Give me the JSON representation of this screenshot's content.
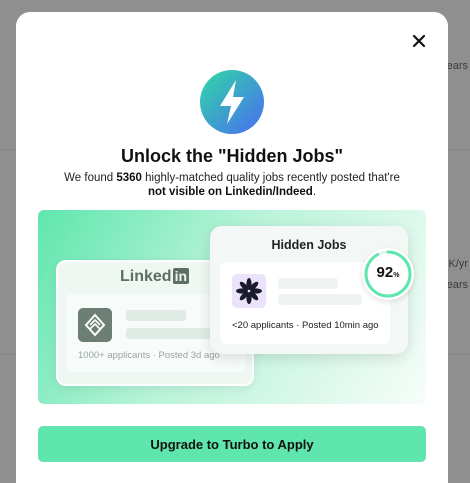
{
  "background": {
    "snippets": [
      "ears",
      "K/yr",
      "ears"
    ]
  },
  "modal": {
    "title": "Unlock the \"Hidden Jobs\"",
    "desc_prefix": "We found ",
    "job_count": "5360",
    "desc_middle": " highly-matched quality jobs recently posted that're",
    "desc_bold": "not visible on Linkedin/Indeed",
    "desc_suffix": ".",
    "linkedin_card": {
      "logo_text": "Linked",
      "logo_in": "in",
      "meta": "1000+ applicants · Posted 3d ago"
    },
    "hidden_jobs_card": {
      "title": "Hidden Jobs",
      "meta": "<20 applicants · Posted 10min ago",
      "score_value": "92",
      "score_unit": "%",
      "score_fraction": 0.92
    },
    "cta_label": "Upgrade to Turbo to Apply",
    "colors": {
      "accent": "#5fe6ae",
      "logo_gradient_start": "#2fd9a4",
      "logo_gradient_end": "#4a6cf2"
    },
    "icons": {
      "close": "close-icon",
      "logo": "lightning-icon",
      "linkedin_company": "cube-logo-icon",
      "hidden_company": "asterisk-flower-icon"
    }
  }
}
